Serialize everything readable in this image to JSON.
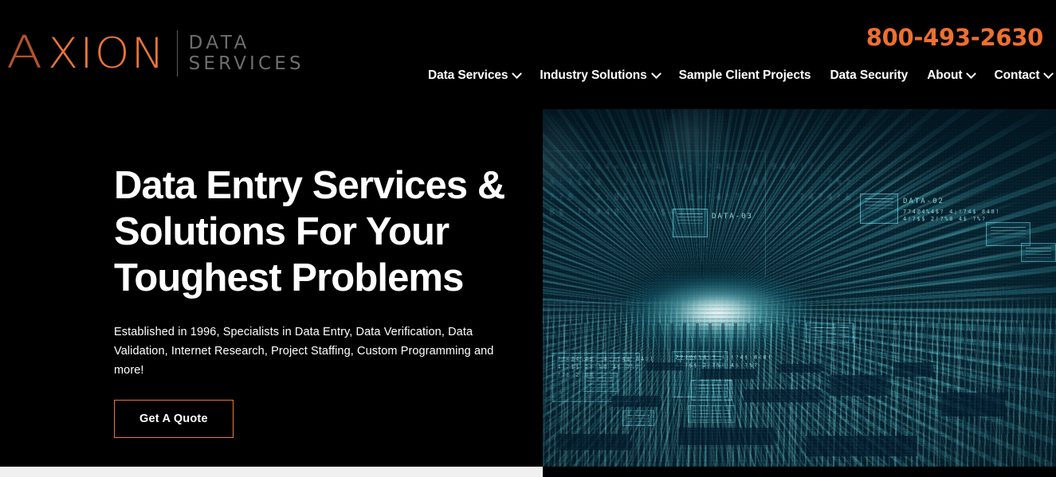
{
  "site": {
    "brand_orange": "#e8763a",
    "brand_orange_dark": "#b4532b",
    "phone_orange": "#ef6f2e",
    "background": "#000000",
    "footer_strip": "#f0f0f0"
  },
  "header": {
    "logo": {
      "letter_a": "A",
      "word": "XION",
      "sub_line1": "DATA",
      "sub_line2": "SERVICES"
    },
    "phone": "800-493-2630",
    "nav": [
      {
        "label": "Data Services",
        "has_dropdown": true
      },
      {
        "label": "Industry Solutions",
        "has_dropdown": true
      },
      {
        "label": "Sample Client Projects",
        "has_dropdown": false
      },
      {
        "label": "Data Security",
        "has_dropdown": false
      },
      {
        "label": "About",
        "has_dropdown": true
      },
      {
        "label": "Contact",
        "has_dropdown": true
      }
    ]
  },
  "hero": {
    "title": "Data Entry Services & Solutions For Your Toughest Problems",
    "subtitle": "Established in 1996, Specialists in Data Entry, Data Verification, Data Validation, Internet Research, Project Staffing, Custom Programming and more!",
    "cta_label": "Get A Quote",
    "image": {
      "alt": "Abstract cyan digital data stream visualization with holographic interface panels",
      "panel_labels": [
        "DATA-02",
        "DATA-03"
      ],
      "panel_code_lines": [
        "7?4@4%4=!4$?  4;!?4$?$  848!?",
        "4!?$$8  2!?%8!^      !8?      ?%?",
        "??8  2:8&      8=!4!?      ?4?4!&",
        "8$ !?#48 ?^?$4!?"
      ],
      "small_panel_text": [
        "7?4@4%4$?  4;!?4$  848!",
        "4!?$$  2!?%8    4$      ?%?",
        "??8  2:8a"
      ],
      "dominant_colors": [
        "#062433",
        "#0d7f9b",
        "#12a0b4",
        "#9ffaff"
      ]
    }
  }
}
